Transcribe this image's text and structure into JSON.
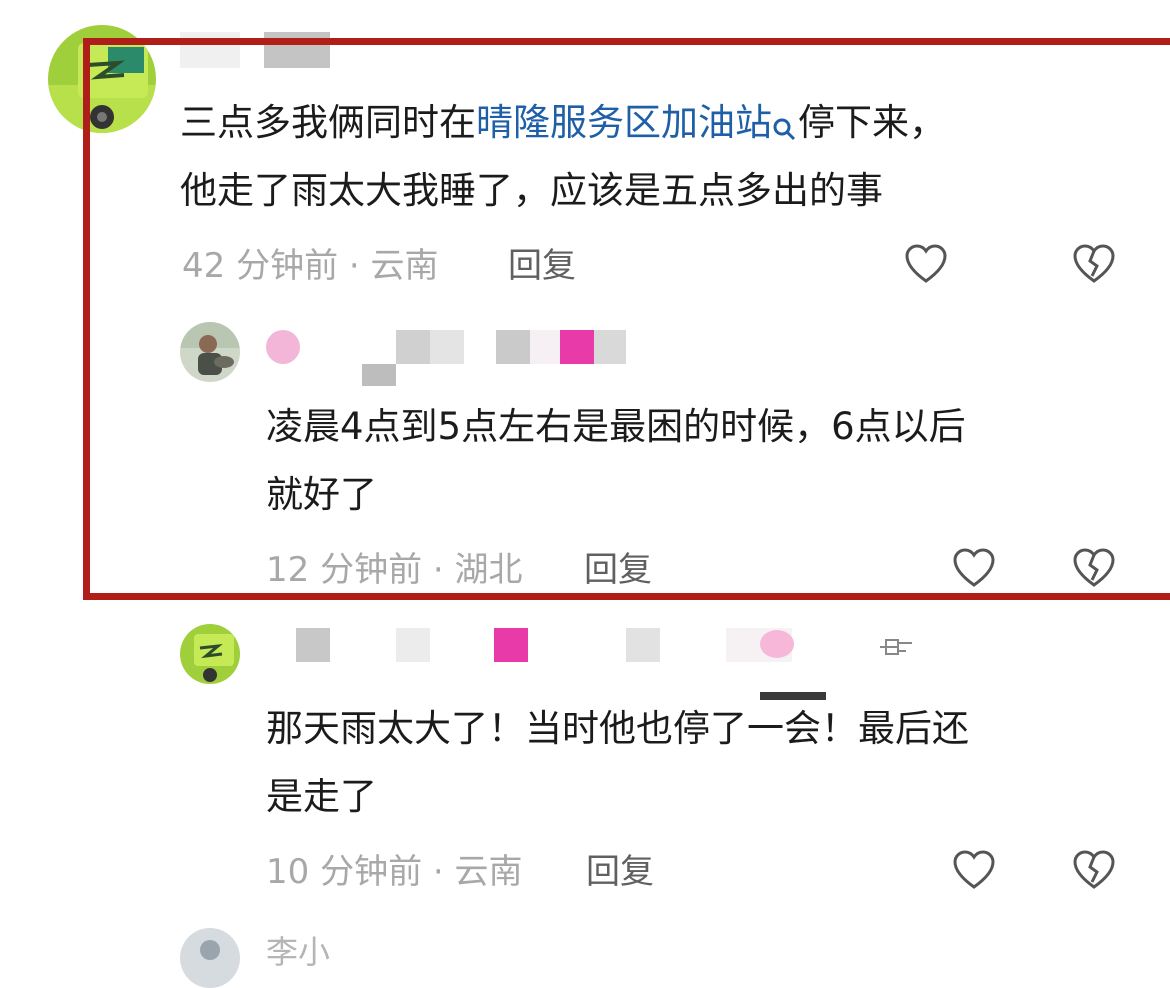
{
  "comments": [
    {
      "text_before_link": "三点多我俩同时在",
      "link_text": "晴隆服务区加油站",
      "text_after_link": "停下来，",
      "text_line2": "他走了雨太大我睡了，应该是五点多出的事",
      "time": "42 分钟前",
      "location": "云南",
      "reply_label": "回复"
    },
    {
      "text_line1": "凌晨4点到5点左右是最困的时候，6点以后",
      "text_line2": "就好了",
      "time": "12 分钟前",
      "location": "湖北",
      "reply_label": "回复"
    },
    {
      "text_line1": "那天雨太大了！当时他也停了一会！最后还",
      "text_line2": "是走了",
      "time": "10 分钟前",
      "location": "云南",
      "reply_label": "回复"
    }
  ],
  "partial_next": {
    "name": "李小"
  },
  "colors": {
    "highlight_border": "#b01e1a",
    "link": "#1e5fa8",
    "meta": "#a8a8a8",
    "body_text": "#1b1b1b",
    "censor_pink": "#e83aa8"
  },
  "icons": [
    "truck-avatar",
    "search-icon",
    "heart-icon",
    "broken-heart-icon",
    "pointing-hand-icon"
  ]
}
